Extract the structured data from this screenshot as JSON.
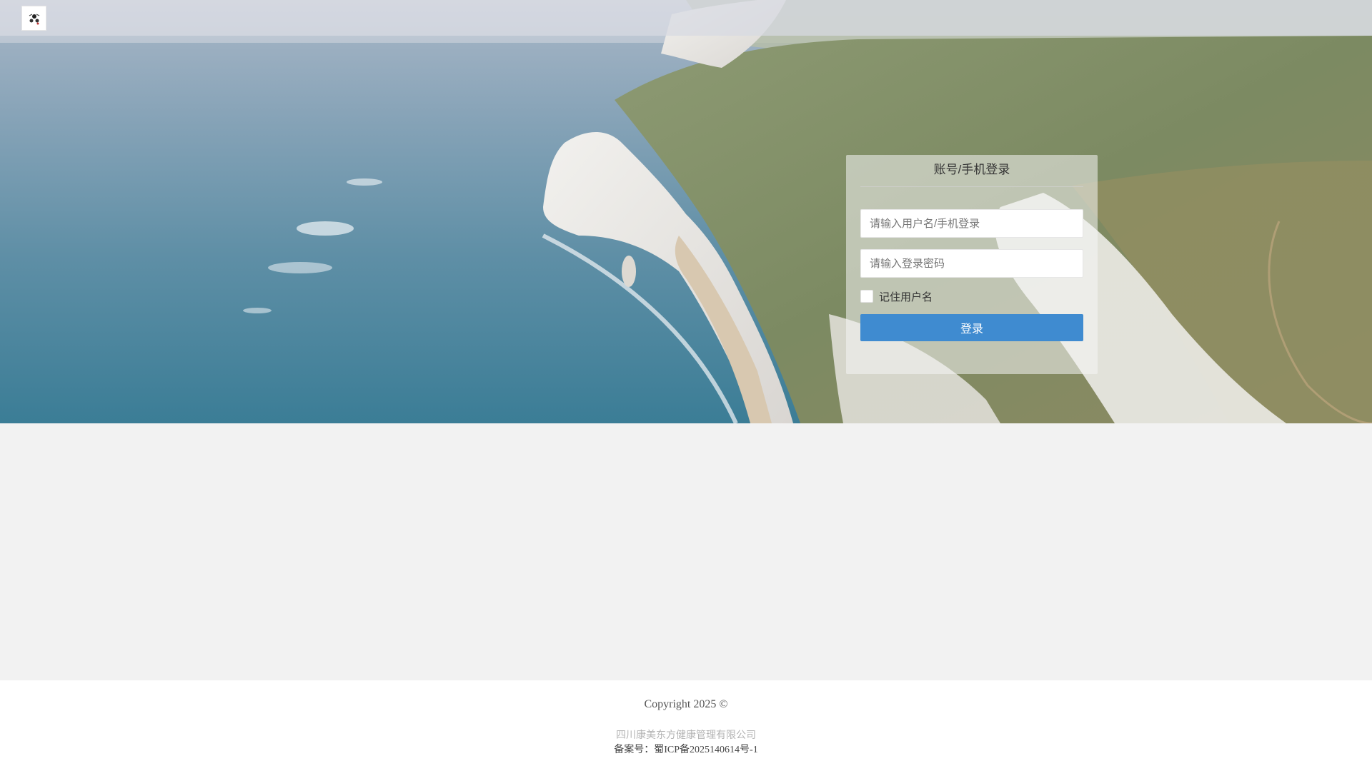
{
  "header": {
    "logo_icon": "brand-logo-icon"
  },
  "login": {
    "title": "账号/手机登录",
    "username_placeholder": "请输入用户名/手机登录",
    "password_placeholder": "请输入登录密码",
    "remember_label": "记住用户名",
    "remember_checked": false,
    "submit_label": "登录"
  },
  "footer": {
    "copyright": "Copyright 2025 ©",
    "company": "四川康美东方健康管理有限公司",
    "icp": "备案号：蜀ICP备2025140614号-1"
  },
  "colors": {
    "primary": "#3f8bd0",
    "page_background": "#f2f2f2",
    "footer_background": "#ffffff"
  }
}
